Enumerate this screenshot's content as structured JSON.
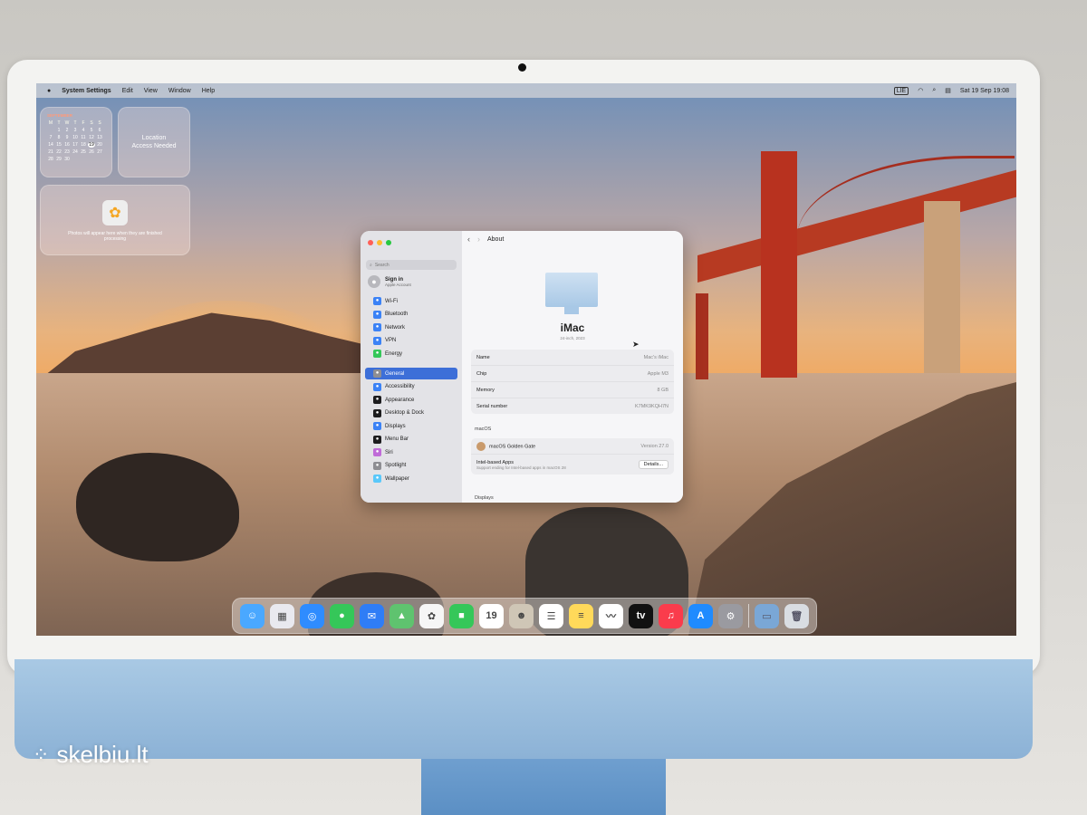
{
  "menubar": {
    "apple_icon": "apple-logo-icon",
    "app_name": "System Settings",
    "items": [
      "Edit",
      "View",
      "Window",
      "Help"
    ],
    "input_source": "LIE",
    "datetime": "Sat 19 Sep  19:08"
  },
  "widgets": {
    "calendar": {
      "month": "SEPTEMBER",
      "weekdays": [
        "M",
        "T",
        "W",
        "T",
        "F",
        "S",
        "S"
      ],
      "days": [
        "",
        "1",
        "2",
        "3",
        "4",
        "5",
        "6",
        "7",
        "8",
        "9",
        "10",
        "11",
        "12",
        "13",
        "14",
        "15",
        "16",
        "17",
        "18",
        "19",
        "20",
        "21",
        "22",
        "23",
        "24",
        "25",
        "26",
        "27",
        "28",
        "29",
        "30",
        "",
        "",
        "",
        "",
        ""
      ],
      "today": "19"
    },
    "location": "Location Access Needed",
    "photos_text": "Photos will appear here when they are finished processing"
  },
  "settings": {
    "search_placeholder": "Search",
    "signin_title": "Sign in",
    "signin_sub": "Apple Account",
    "sidebar": [
      {
        "label": "Wi-Fi",
        "icon": "wifi-icon",
        "color": "#3b82f6"
      },
      {
        "label": "Bluetooth",
        "icon": "bluetooth-icon",
        "color": "#3b82f6"
      },
      {
        "label": "Network",
        "icon": "globe-icon",
        "color": "#3b82f6"
      },
      {
        "label": "VPN",
        "icon": "vpn-icon",
        "color": "#3b82f6"
      },
      {
        "label": "Energy",
        "icon": "energy-icon",
        "color": "#34c759"
      },
      {
        "label": "General",
        "icon": "gear-icon",
        "color": "#8e8e93",
        "selected": true
      },
      {
        "label": "Accessibility",
        "icon": "accessibility-icon",
        "color": "#3b82f6"
      },
      {
        "label": "Appearance",
        "icon": "appearance-icon",
        "color": "#1c1c1e"
      },
      {
        "label": "Desktop & Dock",
        "icon": "dock-icon",
        "color": "#1c1c1e"
      },
      {
        "label": "Displays",
        "icon": "display-icon",
        "color": "#3b82f6"
      },
      {
        "label": "Menu Bar",
        "icon": "menubar-icon",
        "color": "#1c1c1e"
      },
      {
        "label": "Siri",
        "icon": "siri-icon",
        "color": "#c06bd8"
      },
      {
        "label": "Spotlight",
        "icon": "spotlight-icon",
        "color": "#8e8e93"
      },
      {
        "label": "Wallpaper",
        "icon": "wallpaper-icon",
        "color": "#5ac8fa"
      }
    ],
    "page_title": "About",
    "device_name": "iMac",
    "device_model": "24-inch, 2023",
    "specs": [
      {
        "label": "Name",
        "value": "Mac's iMac"
      },
      {
        "label": "Chip",
        "value": "Apple M3"
      },
      {
        "label": "Memory",
        "value": "8 GB"
      },
      {
        "label": "Serial number",
        "value": "K7MK9KQH7N"
      }
    ],
    "macos_header": "macOS",
    "macos_name": "macOS Golden Gate",
    "macos_version": "Version 27.0",
    "intel_title": "Intel-based Apps",
    "intel_sub": "Support ending for Intel-based apps in macOS 28",
    "details_label": "Details...",
    "displays_header": "Displays"
  },
  "dock": [
    {
      "name": "Finder",
      "icon": "finder-icon",
      "color": "#4aa8ff",
      "glyph": "☺"
    },
    {
      "name": "Launchpad",
      "icon": "launchpad-icon",
      "color": "#e9e9ef",
      "glyph": "▦"
    },
    {
      "name": "Safari",
      "icon": "safari-icon",
      "color": "#2f8cff",
      "glyph": "◎"
    },
    {
      "name": "Messages",
      "icon": "messages-icon",
      "color": "#35c759",
      "glyph": "●"
    },
    {
      "name": "Mail",
      "icon": "mail-icon",
      "color": "#2f7df6",
      "glyph": "✉"
    },
    {
      "name": "Maps",
      "icon": "maps-icon",
      "color": "#5fc36f",
      "glyph": "▲"
    },
    {
      "name": "Photos",
      "icon": "photos-icon",
      "color": "#f6f6f6",
      "glyph": "✿"
    },
    {
      "name": "FaceTime",
      "icon": "facetime-icon",
      "color": "#35c759",
      "glyph": "■"
    },
    {
      "name": "Calendar",
      "icon": "calendar-icon",
      "color": "#ffffff",
      "glyph": "19"
    },
    {
      "name": "Contacts",
      "icon": "contacts-icon",
      "color": "#cfc6b6",
      "glyph": "☻"
    },
    {
      "name": "Reminders",
      "icon": "reminders-icon",
      "color": "#ffffff",
      "glyph": "☰"
    },
    {
      "name": "Notes",
      "icon": "notes-icon",
      "color": "#ffd95a",
      "glyph": "≡"
    },
    {
      "name": "Freeform",
      "icon": "freeform-icon",
      "color": "#ffffff",
      "glyph": "〰"
    },
    {
      "name": "Apple TV",
      "icon": "tv-icon",
      "color": "#111111",
      "glyph": "tv"
    },
    {
      "name": "Music",
      "icon": "music-icon",
      "color": "#fa3c4c",
      "glyph": "♫"
    },
    {
      "name": "App Store",
      "icon": "appstore-icon",
      "color": "#1f8bff",
      "glyph": "A"
    },
    {
      "name": "System Settings",
      "icon": "settings-icon",
      "color": "#9a9aa0",
      "glyph": "⚙"
    }
  ],
  "dock_right": [
    {
      "name": "Downloads",
      "icon": "folder-icon",
      "color": "#7aa7d6"
    },
    {
      "name": "Trash",
      "icon": "trash-icon",
      "color": "#d9dde2"
    }
  ],
  "watermark": "skelbiu.lt"
}
